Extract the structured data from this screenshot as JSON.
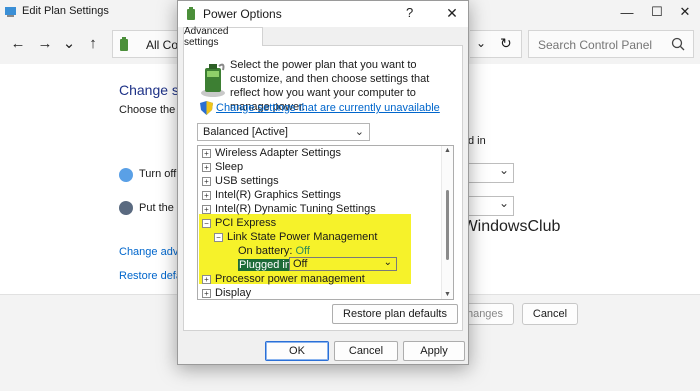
{
  "background_window": {
    "title": "Edit Plan Settings",
    "address_text": "All Co",
    "search_placeholder": "Search Control Panel",
    "heading": "Change set",
    "subtext": "Choose the sle",
    "row_turn_off": "Turn off t",
    "row_put_computer": "Put the co",
    "plugged_in_partial": "d in",
    "link_change_advanced": "Change advan",
    "link_restore_default": "Restore defau",
    "button_save_changes": "hanges",
    "button_cancel": "Cancel"
  },
  "watermark": {
    "text": "TheWindowsClub"
  },
  "dialog": {
    "title": "Power Options",
    "help": "?",
    "close": "✕",
    "tab_label": "Advanced settings",
    "description": "Select the power plan that you want to customize, and then choose settings that reflect how you want your computer to manage power.",
    "change_link": "Change settings that are currently unavailable",
    "plan_select_value": "Balanced [Active]",
    "tree": {
      "items": [
        {
          "expander": "+",
          "label": "Wireless Adapter Settings"
        },
        {
          "expander": "+",
          "label": "Sleep"
        },
        {
          "expander": "+",
          "label": "USB settings"
        },
        {
          "expander": "+",
          "label": "Intel(R) Graphics Settings"
        },
        {
          "expander": "+",
          "label": "Intel(R) Dynamic Tuning Settings"
        },
        {
          "expander": "−",
          "label": "PCI Express"
        },
        {
          "expander": "−",
          "label": "Link State Power Management"
        }
      ],
      "on_battery_label": "On battery:",
      "on_battery_value": "Off",
      "plugged_in_label": "Plugged in:",
      "plugged_in_value": "Off",
      "after_items": [
        {
          "expander": "+",
          "label": "Processor power management"
        },
        {
          "expander": "+",
          "label": "Display"
        }
      ]
    },
    "restore_button": "Restore plan defaults",
    "ok_button": "OK",
    "cancel_button": "Cancel",
    "apply_button": "Apply"
  },
  "colors": {
    "highlight": "#f6f22a",
    "selected_bg": "#1d6b38",
    "link": "#0066cc",
    "heading": "#1e3287"
  },
  "icons": {
    "window_minimize": "—",
    "window_maximize": "☐",
    "window_close": "✕",
    "nav_back": "←",
    "nav_forward": "→",
    "nav_recent": "⌄",
    "nav_up": "↑",
    "refresh": "↻",
    "dropdown": "⌄"
  }
}
